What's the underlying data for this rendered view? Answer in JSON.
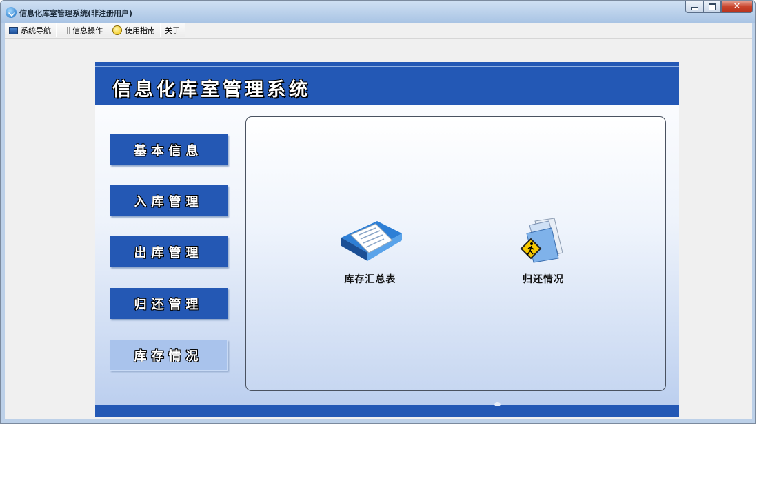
{
  "window": {
    "title": "信息化库室管理系统(非注册用户)",
    "close_glyph": "✕"
  },
  "menu": {
    "items": [
      {
        "label": "系统导航",
        "icon": "monitor-icon"
      },
      {
        "label": "信息操作",
        "icon": "grid-icon"
      },
      {
        "label": "使用指南",
        "icon": "smiley-icon"
      },
      {
        "label": "关于"
      }
    ]
  },
  "panel": {
    "header_title": "信息化库室管理系统",
    "nav": [
      {
        "label": "基本信息"
      },
      {
        "label": "入库管理"
      },
      {
        "label": "出库管理"
      },
      {
        "label": "归还管理"
      },
      {
        "label": "库存情况",
        "active": true
      }
    ],
    "tiles": [
      {
        "label": "库存汇总表",
        "icon": "book-icon"
      },
      {
        "label": "归还情况",
        "icon": "folder-walker-icon"
      }
    ]
  },
  "colors": {
    "accent": "#2358b5",
    "active_nav": "#a9c3ec"
  }
}
